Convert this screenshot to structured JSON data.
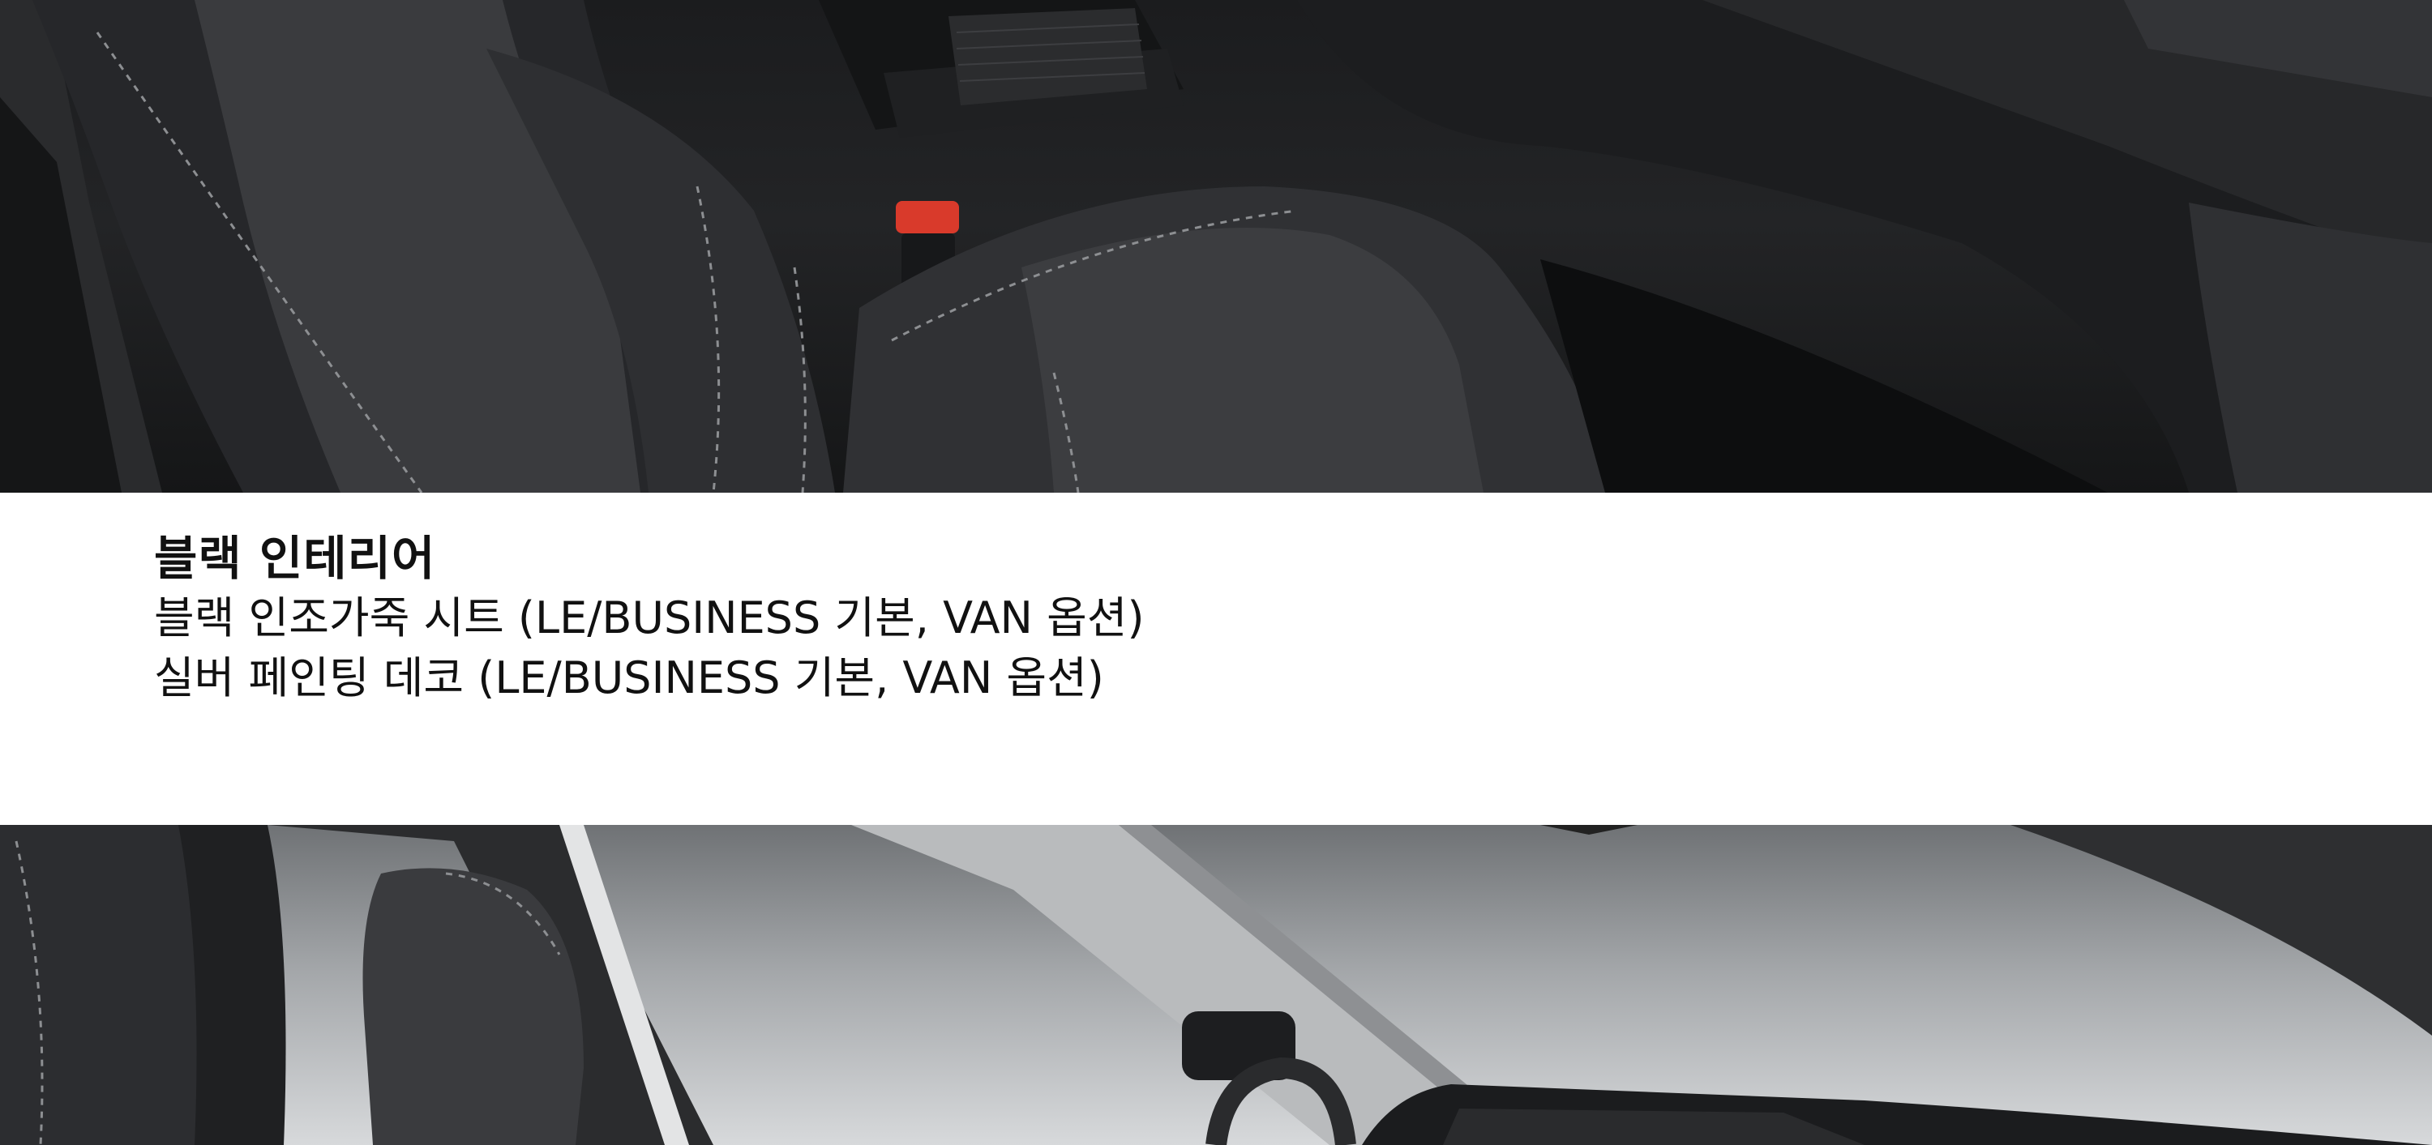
{
  "interior": {
    "title": "블랙 인테리어",
    "lines": [
      "블랙 인조가죽 시트 (LE/BUSINESS 기본, VAN 옵션)",
      "실버 페인팅 데코 (LE/BUSINESS 기본, VAN 옵션)"
    ]
  },
  "images": {
    "top": {
      "icon": "seat-interior-photo",
      "tone": "#1e1f21",
      "accent": "#d93a2b"
    },
    "bottom": {
      "icon": "cabin-view-photo",
      "tone": "#9a9da0"
    }
  }
}
